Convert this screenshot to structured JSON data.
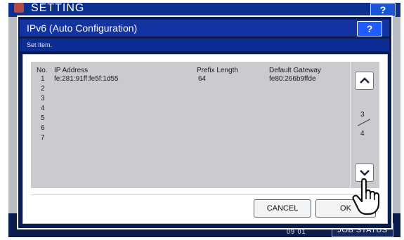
{
  "app": {
    "title": "SETTING",
    "help_label": "?",
    "clock": "09 01",
    "job_status_label": "JOB STATUS"
  },
  "dialog": {
    "title": "IPv6 (Auto Configuration)",
    "help_label": "?",
    "hint": "Set Item.",
    "columns": {
      "no": "No.",
      "ip": "IP Address",
      "prefix": "Prefix Length",
      "gateway": "Default Gateway"
    },
    "rows": [
      {
        "no": "1",
        "ip": "fe:281:91ff:fe5f:1d55",
        "prefix": "64",
        "gateway": "fe80:266b9ffde"
      },
      {
        "no": "2",
        "ip": "",
        "prefix": "",
        "gateway": ""
      },
      {
        "no": "3",
        "ip": "",
        "prefix": "",
        "gateway": ""
      },
      {
        "no": "4",
        "ip": "",
        "prefix": "",
        "gateway": ""
      },
      {
        "no": "5",
        "ip": "",
        "prefix": "",
        "gateway": ""
      },
      {
        "no": "6",
        "ip": "",
        "prefix": "",
        "gateway": ""
      },
      {
        "no": "7",
        "ip": "",
        "prefix": "",
        "gateway": ""
      }
    ],
    "pagination": {
      "current": "3",
      "total": "4"
    },
    "buttons": {
      "cancel": "CANCEL",
      "ok": "OK"
    }
  },
  "icons": {
    "scroll_up": "chevron-up-icon",
    "scroll_down": "chevron-down-icon",
    "pointer": "hand-pointer-icon",
    "logo": "machine-logo-icon"
  },
  "colors": {
    "title_bar": "#1433a3",
    "frame": "#0b1d4e",
    "help_button": "#1e5cff",
    "list_background": "#c9cbcf"
  }
}
